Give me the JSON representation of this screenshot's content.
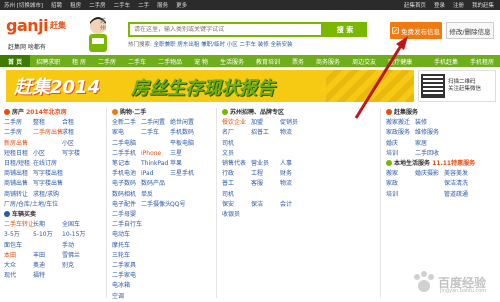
{
  "topbar": {
    "city": "苏州 [切换城市]",
    "items": [
      "招聘",
      "租房",
      "二手房",
      "二手车",
      "二手",
      "服务",
      "更多"
    ],
    "right": [
      "赶集首页",
      "登录",
      "注册",
      "我的赶集"
    ]
  },
  "logo": {
    "text": "ganji",
    "cn": "赶集",
    "slogan": "赶集网 啥都有"
  },
  "city_side": "苏州",
  "search": {
    "placeholder": "请在这里，输入类别或关键字试试",
    "button": "搜 索",
    "hot_label": "热门搜索:",
    "hot": "全职兼职 房东出租 兼职/临时 小区 二手车 装修 全新安装"
  },
  "post_button": "免费发布信息",
  "edit_button": "修改/删除信息",
  "nav": [
    "首 页",
    "招聘求职",
    "租 房",
    "二手房",
    "二手车",
    "二手物品",
    "宠 物",
    "生活服务",
    "教育培训",
    "票务",
    "商务服务",
    "周边交友",
    "医疗健康",
    "",
    "",
    "",
    "",
    "手机赶集",
    "手机租房"
  ],
  "banner": {
    "b1": "赶集2014",
    "b2": "房丝生存现状报告"
  },
  "qr": {
    "line1": "扫描二维码",
    "line2": "关注赶集微信"
  },
  "col1": {
    "house_hd": "房产",
    "house_note": "2014年北京房",
    "house": [
      [
        "二手房",
        "整租",
        "合租"
      ],
      [
        "二手房",
        "二手房出售",
        "求租"
      ],
      [
        "新房出售",
        "",
        "小区"
      ],
      [
        "短租日租",
        "小区",
        "写字楼"
      ],
      [
        "日租/短租",
        "在线订房",
        ""
      ],
      [
        "商铺出租",
        "写字楼出租",
        ""
      ],
      [
        "商铺出售",
        "写字楼出售",
        ""
      ],
      [
        "商铺转让",
        "求租/求购",
        ""
      ],
      [
        "厂房/仓库/土地/车位",
        ""
      ]
    ],
    "car_hd": "车辆买卖",
    "car": [
      [
        "二手车转让",
        "长期",
        "全国车"
      ],
      [
        "3-5万",
        "5-10万",
        "10-15万"
      ],
      [
        "面包车",
        "",
        "手动"
      ],
      [
        "本田",
        "丰田",
        "雪佛兰"
      ],
      [
        "大众",
        "奥迪",
        "别克"
      ],
      [
        "现代",
        "福特",
        ""
      ]
    ]
  },
  "col2": {
    "hd": "购物·二手",
    "items": [
      [
        "全新二手",
        "二手闲置",
        "绝世闲置"
      ],
      [
        "家电",
        "二手车",
        "手机数码"
      ],
      [
        "二手电脑",
        "",
        "平板电脑"
      ],
      [
        "二手手机",
        "iPhone",
        "三星"
      ],
      [
        "笔记本",
        "ThinkPad",
        "苹果"
      ],
      [
        "手机电池",
        "iPad",
        "三星手机"
      ],
      [
        "电子数码",
        "数码产品",
        ""
      ],
      [
        "数码相机",
        "单反",
        ""
      ],
      [
        "电子配件",
        "二手摄像头",
        "QQ号"
      ],
      [
        "二手母婴",
        "",
        ""
      ],
      [
        "二手自行车",
        "",
        ""
      ],
      [
        "电动车",
        "",
        ""
      ],
      [
        "摩托车",
        "",
        ""
      ],
      [
        "三轮车",
        "",
        ""
      ],
      [
        "二手家具",
        "",
        ""
      ],
      [
        "二手家电",
        "",
        ""
      ],
      [
        "电冰箱",
        "",
        ""
      ],
      [
        "空调",
        "",
        ""
      ]
    ]
  },
  "col3": {
    "hd": "苏州招聘、品牌专区",
    "items": [
      [
        "餐饮企业",
        "加盟",
        "促销员"
      ],
      [
        "名厂",
        "招普工",
        "物流"
      ],
      [
        "司机",
        "",
        ""
      ],
      [
        "文员",
        "",
        ""
      ],
      [
        "销售代表",
        "营业员",
        "人事"
      ],
      [
        "行政",
        "工程",
        "财务"
      ],
      [
        "普工",
        "客服",
        "物流"
      ],
      [
        "司机",
        "",
        ""
      ],
      [
        "保安",
        "保洁",
        "会计"
      ],
      [
        "收银员",
        "",
        ""
      ],
      [
        "",
        ""
      ],
      [
        "",
        ""
      ]
    ]
  },
  "col4": {
    "hd": "赶集服务",
    "items": [
      [
        "搬家搬迁",
        "装修"
      ],
      [
        "家政服务",
        "维修服务"
      ],
      [
        "婚庆",
        "家居"
      ],
      [
        "培训",
        "二手回收"
      ]
    ],
    "hd2": "本地生活服务",
    "hd2_note": "11.11特惠服务",
    "items2": [
      [
        "搬家",
        "婚庆摄影",
        "美容美发"
      ],
      [
        "家政",
        "",
        "保洁清洗"
      ],
      [
        "培训",
        "",
        "管道疏通"
      ]
    ]
  },
  "watermark": {
    "t": "百度经验",
    "s": "jingyan.baidu.com"
  }
}
